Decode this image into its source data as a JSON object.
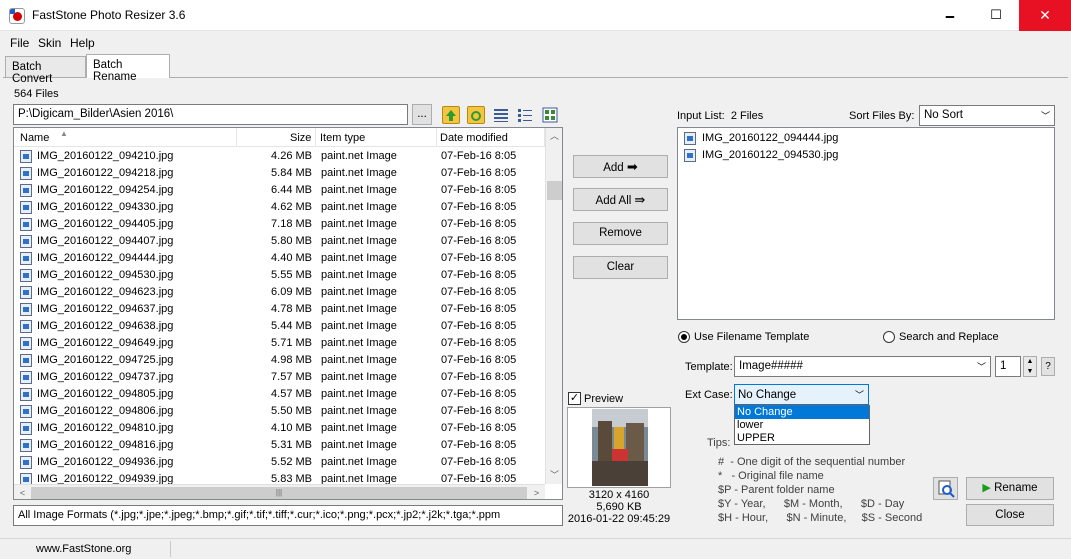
{
  "window": {
    "title": "FastStone Photo Resizer 3.6",
    "minimize_glyph": "🗕",
    "maximize_glyph": "☐",
    "close_glyph": "✕"
  },
  "menu": [
    "File",
    "Skin",
    "Help"
  ],
  "tabs": [
    "Batch Convert",
    "Batch Rename"
  ],
  "file_count": "564 Files",
  "path": "P:\\Digicam_Bilder\\Asien 2016\\",
  "browse_label": "...",
  "columns": {
    "name": "Name",
    "size": "Size",
    "type": "Item type",
    "modified": "Date modified"
  },
  "files": [
    {
      "name": "IMG_20160122_094210.jpg",
      "size": "4.26 MB",
      "type": "paint.net Image",
      "date": "07-Feb-16 8:05"
    },
    {
      "name": "IMG_20160122_094218.jpg",
      "size": "5.84 MB",
      "type": "paint.net Image",
      "date": "07-Feb-16 8:05"
    },
    {
      "name": "IMG_20160122_094254.jpg",
      "size": "6.44 MB",
      "type": "paint.net Image",
      "date": "07-Feb-16 8:05"
    },
    {
      "name": "IMG_20160122_094330.jpg",
      "size": "4.62 MB",
      "type": "paint.net Image",
      "date": "07-Feb-16 8:05"
    },
    {
      "name": "IMG_20160122_094405.jpg",
      "size": "7.18 MB",
      "type": "paint.net Image",
      "date": "07-Feb-16 8:05"
    },
    {
      "name": "IMG_20160122_094407.jpg",
      "size": "5.80 MB",
      "type": "paint.net Image",
      "date": "07-Feb-16 8:05"
    },
    {
      "name": "IMG_20160122_094444.jpg",
      "size": "4.40 MB",
      "type": "paint.net Image",
      "date": "07-Feb-16 8:05"
    },
    {
      "name": "IMG_20160122_094530.jpg",
      "size": "5.55 MB",
      "type": "paint.net Image",
      "date": "07-Feb-16 8:05"
    },
    {
      "name": "IMG_20160122_094623.jpg",
      "size": "6.09 MB",
      "type": "paint.net Image",
      "date": "07-Feb-16 8:05"
    },
    {
      "name": "IMG_20160122_094637.jpg",
      "size": "4.78 MB",
      "type": "paint.net Image",
      "date": "07-Feb-16 8:05"
    },
    {
      "name": "IMG_20160122_094638.jpg",
      "size": "5.44 MB",
      "type": "paint.net Image",
      "date": "07-Feb-16 8:05"
    },
    {
      "name": "IMG_20160122_094649.jpg",
      "size": "5.71 MB",
      "type": "paint.net Image",
      "date": "07-Feb-16 8:05"
    },
    {
      "name": "IMG_20160122_094725.jpg",
      "size": "4.98 MB",
      "type": "paint.net Image",
      "date": "07-Feb-16 8:05"
    },
    {
      "name": "IMG_20160122_094737.jpg",
      "size": "7.57 MB",
      "type": "paint.net Image",
      "date": "07-Feb-16 8:05"
    },
    {
      "name": "IMG_20160122_094805.jpg",
      "size": "4.57 MB",
      "type": "paint.net Image",
      "date": "07-Feb-16 8:05"
    },
    {
      "name": "IMG_20160122_094806.jpg",
      "size": "5.50 MB",
      "type": "paint.net Image",
      "date": "07-Feb-16 8:05"
    },
    {
      "name": "IMG_20160122_094810.jpg",
      "size": "4.10 MB",
      "type": "paint.net Image",
      "date": "07-Feb-16 8:05"
    },
    {
      "name": "IMG_20160122_094816.jpg",
      "size": "5.31 MB",
      "type": "paint.net Image",
      "date": "07-Feb-16 8:05"
    },
    {
      "name": "IMG_20160122_094936.jpg",
      "size": "5.52 MB",
      "type": "paint.net Image",
      "date": "07-Feb-16 8:05"
    },
    {
      "name": "IMG_20160122_094939.jpg",
      "size": "5.83 MB",
      "type": "paint.net Image",
      "date": "07-Feb-16 8:05"
    }
  ],
  "filter": "All Image Formats (*.jpg;*.jpe;*.jpeg;*.bmp;*.gif;*.tif;*.tiff;*.cur;*.ico;*.png;*.pcx;*.jp2;*.j2k;*.tga;*.ppm",
  "buttons": {
    "add": "Add",
    "add_all": "Add All",
    "remove": "Remove",
    "clear": "Clear",
    "rename": "Rename",
    "close": "Close"
  },
  "preview": {
    "label": "Preview",
    "dimensions": "3120 x 4160",
    "filesize": "5,690 KB",
    "datetime": "2016-01-22 09:45:29"
  },
  "input_list": {
    "label": "Input List:",
    "count": "2 Files",
    "items": [
      "IMG_20160122_094444.jpg",
      "IMG_20160122_094530.jpg"
    ]
  },
  "sort": {
    "label": "Sort Files By:",
    "value": "No Sort"
  },
  "mode": {
    "template_label": "Use Filename Template",
    "search_label": "Search and Replace"
  },
  "template": {
    "label": "Template:",
    "value": "Image#####",
    "start": "1",
    "help": "?"
  },
  "ext_case": {
    "label": "Ext Case:",
    "value": "No Change",
    "options": [
      "No Change",
      "lower",
      "UPPER"
    ]
  },
  "tips": {
    "label": "Tips:",
    "lines": [
      "#  - One digit of the sequential number",
      "*   - Original file name",
      "$P - Parent folder name",
      "$Y - Year,      $M - Month,      $D - Day",
      "$H - Hour,      $N - Minute,     $S - Second"
    ]
  },
  "status": "www.FastStone.org",
  "colors": {
    "accent": "#0078d7",
    "selection": "#3399ff",
    "close_red": "#e81123"
  }
}
